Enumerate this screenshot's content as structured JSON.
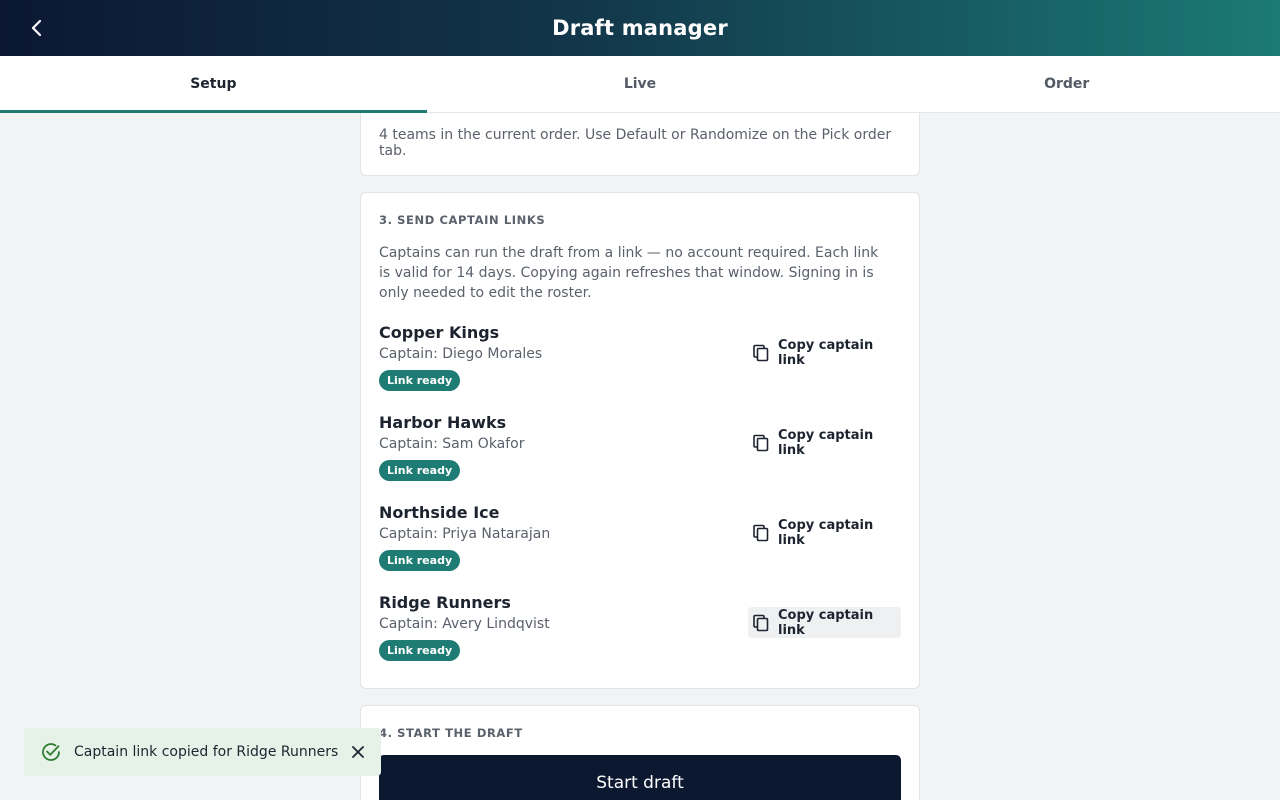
{
  "header": {
    "title": "Draft manager"
  },
  "tabs": [
    {
      "label": "Setup",
      "active": true
    },
    {
      "label": "Live",
      "active": false
    },
    {
      "label": "Order",
      "active": false
    }
  ],
  "order_note": "4 teams in the current order. Use Default or Randomize on the Pick order tab.",
  "captain_links": {
    "heading": "3. SEND CAPTAIN LINKS",
    "description": "Captains can run the draft from a link — no account required. Each link is valid for 14 days. Copying again refreshes that window. Signing in is only needed to edit the roster.",
    "copy_label": "Copy captain link",
    "teams": [
      {
        "name": "Copper Kings",
        "captain": "Captain: Diego Morales",
        "badge": "Link ready"
      },
      {
        "name": "Harbor Hawks",
        "captain": "Captain: Sam Okafor",
        "badge": "Link ready"
      },
      {
        "name": "Northside Ice",
        "captain": "Captain: Priya Natarajan",
        "badge": "Link ready"
      },
      {
        "name": "Ridge Runners",
        "captain": "Captain: Avery Lindqvist",
        "badge": "Link ready"
      }
    ]
  },
  "start": {
    "heading": "4. START THE DRAFT",
    "button_label": "Start draft"
  },
  "toast": {
    "message": "Captain link copied for Ridge Runners"
  },
  "icons": {
    "back": "chevron-left-icon",
    "copy": "copy-icon",
    "success": "check-circle-icon",
    "close": "close-icon"
  },
  "colors": {
    "accent": "#1f7c74",
    "header_start": "#0b1733",
    "header_end": "#1b7a74",
    "primary_button": "#0c1730",
    "toast_bg": "#e6f1e7",
    "success": "#2e7d32"
  }
}
